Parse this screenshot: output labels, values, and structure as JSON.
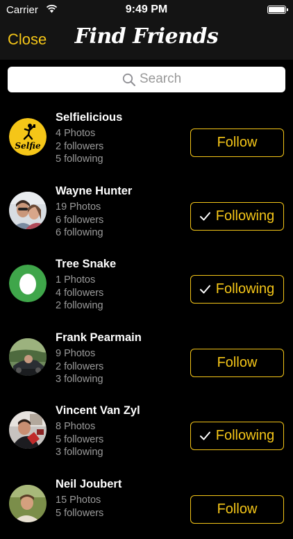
{
  "status_bar": {
    "carrier": "Carrier",
    "time": "9:49 PM"
  },
  "nav": {
    "close_label": "Close",
    "title": "Find Friends"
  },
  "search": {
    "placeholder": "Search"
  },
  "colors": {
    "accent": "#f5c618",
    "background": "#000000",
    "secondary_text": "#9b9b9b"
  },
  "users": [
    {
      "name": "Selfielicious",
      "photos": "4 Photos",
      "followers": "2 followers",
      "following": "5 following",
      "button_label": "Follow",
      "is_following": false,
      "avatar": "selfie-logo"
    },
    {
      "name": "Wayne Hunter",
      "photos": "19 Photos",
      "followers": "6 followers",
      "following": "6 following",
      "button_label": "Following",
      "is_following": true,
      "avatar": "photo"
    },
    {
      "name": "Tree Snake",
      "photos": "1 Photos",
      "followers": "4 followers",
      "following": "2 following",
      "button_label": "Following",
      "is_following": true,
      "avatar": "egg"
    },
    {
      "name": "Frank Pearmain",
      "photos": "9 Photos",
      "followers": "2 followers",
      "following": "3 following",
      "button_label": "Follow",
      "is_following": false,
      "avatar": "photo"
    },
    {
      "name": "Vincent Van Zyl",
      "photos": "8 Photos",
      "followers": "5 followers",
      "following": "3 following",
      "button_label": "Following",
      "is_following": true,
      "avatar": "photo"
    },
    {
      "name": "Neil Joubert",
      "photos": "15 Photos",
      "followers": "5 followers",
      "following": "",
      "button_label": "Follow",
      "is_following": false,
      "avatar": "photo"
    }
  ]
}
